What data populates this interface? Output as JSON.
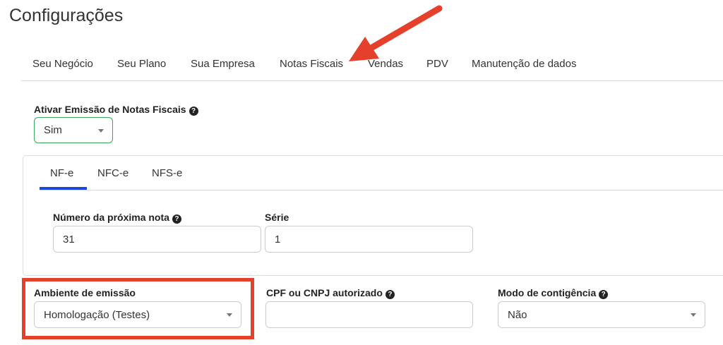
{
  "page_title": "Configurações",
  "main_tabs": [
    {
      "label": "Seu Negócio"
    },
    {
      "label": "Seu Plano"
    },
    {
      "label": "Sua Empresa"
    },
    {
      "label": "Notas Fiscais",
      "active": true
    },
    {
      "label": "Vendas"
    },
    {
      "label": "PDV"
    },
    {
      "label": "Manutenção de dados"
    }
  ],
  "emission": {
    "label": "Ativar Emissão de Notas Fiscais",
    "value": "Sim"
  },
  "sub_tabs": [
    {
      "label": "NF-e",
      "active": true
    },
    {
      "label": "NFC-e"
    },
    {
      "label": "NFS-e"
    }
  ],
  "next_number": {
    "label": "Número da próxima nota",
    "value": "31"
  },
  "serie": {
    "label": "Série",
    "value": "1"
  },
  "ambiente": {
    "label": "Ambiente de emissão",
    "value": "Homologação (Testes)"
  },
  "cpf_cnpj": {
    "label": "CPF ou CNPJ autorizado",
    "value": ""
  },
  "contingencia": {
    "label": "Modo de contigência",
    "value": "Não"
  },
  "colors": {
    "accent": "#1b48d9",
    "annotation": "#e4402b",
    "active_select_border": "#3aa65a"
  },
  "icons": [
    "question-circle-icon",
    "caret-down-icon",
    "annotation-arrow",
    "annotation-highlight-box"
  ]
}
